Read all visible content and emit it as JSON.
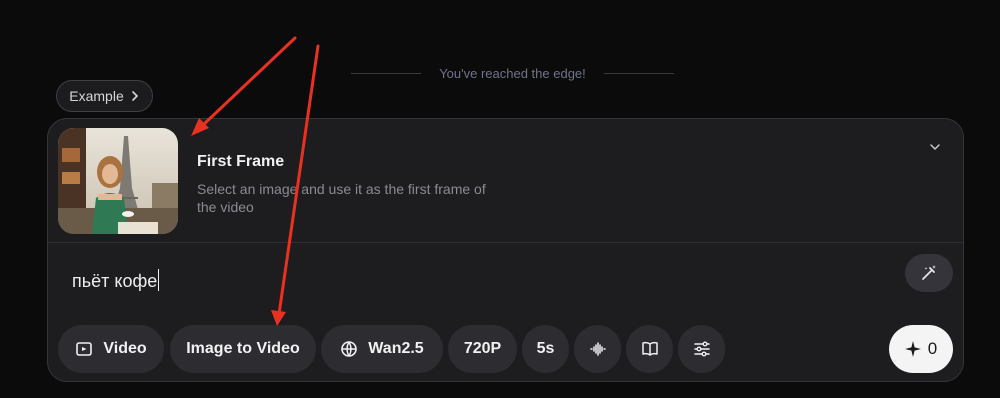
{
  "edge_banner": {
    "text": "You've reached the edge!"
  },
  "example_button": {
    "label": "Example",
    "icon": "chevron-right-icon"
  },
  "first_frame": {
    "title": "First Frame",
    "description": "Select an image and use it as the first frame of the video",
    "collapse_icon": "chevron-down-icon"
  },
  "prompt": {
    "value": "пьёт кофе"
  },
  "toolbar": {
    "items": [
      {
        "label": "Video",
        "icon": "video-icon"
      },
      {
        "label": "Image to Video",
        "icon": ""
      },
      {
        "label": "Wan2.5",
        "icon": "model-globe-icon"
      },
      {
        "label": "720P",
        "icon": ""
      },
      {
        "label": "5s",
        "icon": ""
      },
      {
        "label": "",
        "icon": "audio-wave-icon"
      },
      {
        "label": "",
        "icon": "book-icon"
      },
      {
        "label": "",
        "icon": "sliders-icon"
      }
    ]
  },
  "generate_button": {
    "label": "0",
    "icon": "sparkle-icon"
  },
  "colors": {
    "accent_arrow": "#e8321f",
    "panel_bg": "#1d1d20",
    "page_bg": "#0b0b0c"
  }
}
